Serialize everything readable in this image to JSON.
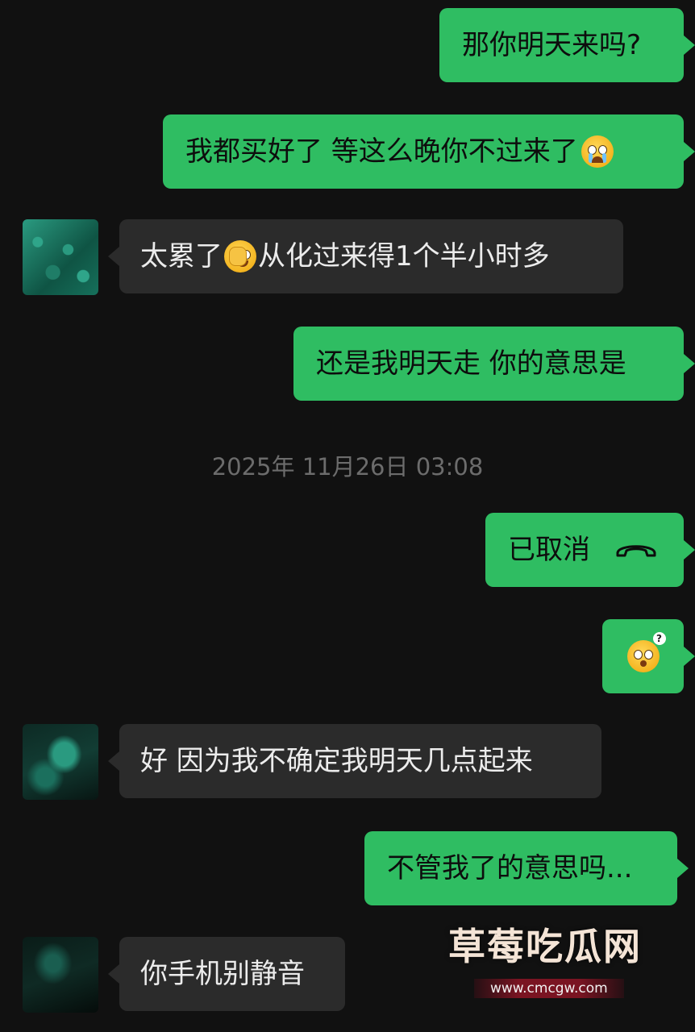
{
  "chat": {
    "messages": [
      {
        "side": "out",
        "text": "那你明天来吗?"
      },
      {
        "side": "out",
        "text": "我都买好了 等这么晚你不过来了",
        "emoji": "crying-face-emoji"
      },
      {
        "side": "in",
        "text_before": "太累了",
        "emoji": "facepalm-laughing-emoji",
        "text_after": "从化过来得1个半小时多"
      },
      {
        "side": "out",
        "text": "还是我明天走 你的意思是"
      },
      {
        "side": "out",
        "text": "已取消",
        "icon": "phone-hangup-icon"
      },
      {
        "side": "out",
        "emoji": "confused-question-emoji"
      },
      {
        "side": "in",
        "text": "好 因为我不确定我明天几点起来"
      },
      {
        "side": "out",
        "text": "不管我了的意思吗..."
      },
      {
        "side": "in",
        "text": "你手机别静音"
      }
    ],
    "timestamp": "2025年 11月26日 03:08"
  },
  "watermark": {
    "title": "草莓吃瓜网",
    "url": "www.cmcgw.com"
  },
  "colors": {
    "background": "#111111",
    "outgoing_bubble": "#2fbd62",
    "incoming_bubble": "#2b2b2b",
    "timestamp_text": "#6c6c6c"
  }
}
